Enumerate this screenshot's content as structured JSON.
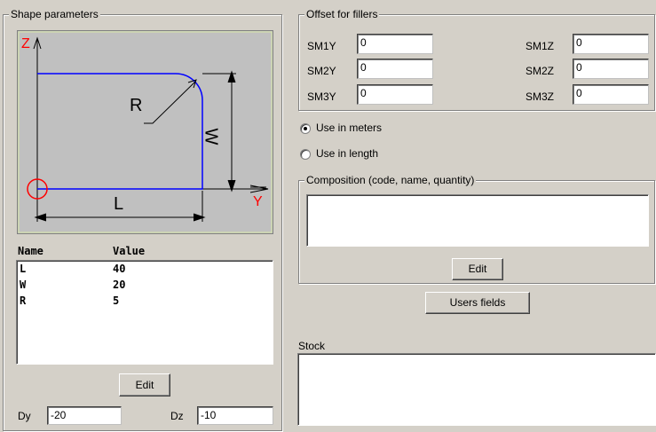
{
  "shape_params": {
    "title": "Shape parameters",
    "diagram_labels": {
      "z": "Z",
      "y": "Y",
      "r": "R",
      "l": "L",
      "w": "W"
    },
    "table": {
      "headers": [
        "Name",
        "Value"
      ],
      "rows": [
        {
          "name": "L",
          "value": "40"
        },
        {
          "name": "W",
          "value": "20"
        },
        {
          "name": "R",
          "value": "5"
        }
      ]
    },
    "edit_label": "Edit",
    "dy_label": "Dy",
    "dy_value": "-20",
    "dz_label": "Dz",
    "dz_value": "-10"
  },
  "offset": {
    "title": "Offset for fillers",
    "fields": [
      {
        "label": "SM1Y",
        "value": "0"
      },
      {
        "label": "SM2Y",
        "value": "0"
      },
      {
        "label": "SM3Y",
        "value": "0"
      },
      {
        "label": "SM1Z",
        "value": "0"
      },
      {
        "label": "SM2Z",
        "value": "0"
      },
      {
        "label": "SM3Z",
        "value": "0"
      }
    ]
  },
  "use_mode": {
    "options": [
      {
        "label": "Use in meters",
        "selected": true
      },
      {
        "label": "Use in length",
        "selected": false
      }
    ]
  },
  "composition": {
    "title": "Composition (code, name, quantity)",
    "edit_label": "Edit"
  },
  "users_fields_label": "Users fields",
  "stock": {
    "label": "Stock"
  },
  "colors": {
    "shape": "#0000ff",
    "origin": "#ff0000",
    "canvas": "#c0c0c0",
    "canvas_border": "#c8d8a0"
  }
}
